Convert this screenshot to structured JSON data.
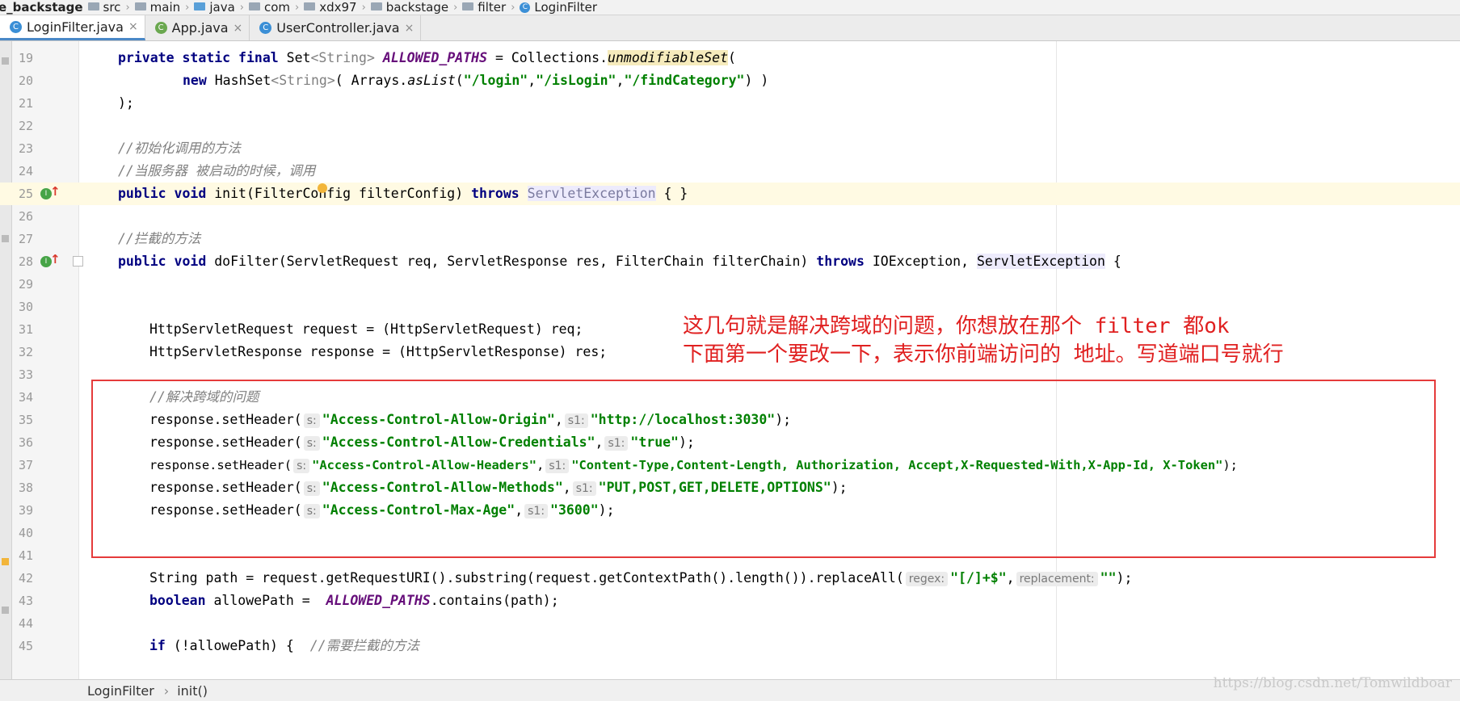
{
  "breadcrumb": [
    "e_backstage",
    "src",
    "main",
    "java",
    "com",
    "xdx97",
    "backstage",
    "filter",
    "LoginFilter"
  ],
  "tabs": [
    {
      "label": "LoginFilter.java",
      "active": true,
      "icon": "class-icon"
    },
    {
      "label": "App.java",
      "active": false,
      "icon": "spring-class-icon"
    },
    {
      "label": "UserController.java",
      "active": false,
      "icon": "class-icon"
    }
  ],
  "tab_close_glyph": "×",
  "line_numbers": [
    "19",
    "20",
    "21",
    "22",
    "23",
    "24",
    "25",
    "26",
    "27",
    "28",
    "29",
    "30",
    "31",
    "32",
    "33",
    "34",
    "35",
    "36",
    "37",
    "38",
    "39",
    "40",
    "41",
    "42",
    "43",
    "44",
    "45"
  ],
  "code": {
    "l19": {
      "private": "private",
      "static": "static",
      "final": "final",
      "set": "Set",
      "gen": "<String>",
      "const": "ALLOWED_PATHS",
      "eq": " = Collections.",
      "method": "unmodifiableSet",
      "tail": "("
    },
    "l20": {
      "new": "new",
      "type": " HashSet",
      "gen": "<String>",
      "mid": "( Arrays.",
      "method": "asList",
      "open": "(",
      "s1": "\"/login\"",
      "c1": ",",
      "s2": "\"/isLogin\"",
      "c2": ",",
      "s3": "\"/findCategory\"",
      "tail": ") )"
    },
    "l21": {
      "text": ");"
    },
    "l23": {
      "comment": "//初始化调用的方法"
    },
    "l24": {
      "comment": "//当服务器 被启动的时候，调用"
    },
    "l25": {
      "public": "public",
      "void": "void",
      "sig": " init(FilterConfig filterConfig) ",
      "throws": "throws",
      "exc": "ServletException",
      "tail": " { }"
    },
    "l27": {
      "comment": "//拦截的方法"
    },
    "l28": {
      "public": "public",
      "void": "void",
      "sig": " doFilter(ServletRequest req, ServletResponse res, FilterChain filterChain) ",
      "throws": "throws",
      "mid": " IOException, ",
      "exc": "ServletException",
      "tail": " {"
    },
    "l31": {
      "text": "HttpServletRequest request = (HttpServletRequest) req;"
    },
    "l32": {
      "text": "HttpServletResponse response = (HttpServletResponse) res;"
    },
    "l34": {
      "comment": "//解决跨域的问题"
    },
    "l35": {
      "pre": "response.setHeader(",
      "h1": "s:",
      "s1": "\"Access-Control-Allow-Origin\"",
      "c": ",",
      "h2": "s1:",
      "s2": "\"http://localhost:3030\"",
      "tail": ");"
    },
    "l36": {
      "pre": "response.setHeader(",
      "h1": "s:",
      "s1": "\"Access-Control-Allow-Credentials\"",
      "c": ",",
      "h2": "s1:",
      "s2": "\"true\"",
      "tail": ");"
    },
    "l37": {
      "pre": "response.setHeader(",
      "h1": "s:",
      "s1": "\"Access-Control-Allow-Headers\"",
      "c": ",",
      "h2": "s1:",
      "s2": "\"Content-Type,Content-Length, Authorization, Accept,X-Requested-With,X-App-Id, X-Token\"",
      "tail": ");"
    },
    "l38": {
      "pre": "response.setHeader(",
      "h1": "s:",
      "s1": "\"Access-Control-Allow-Methods\"",
      "c": ",",
      "h2": "s1:",
      "s2": "\"PUT,POST,GET,DELETE,OPTIONS\"",
      "tail": ");"
    },
    "l39": {
      "pre": "response.setHeader(",
      "h1": "s:",
      "s1": "\"Access-Control-Max-Age\"",
      "c": ",",
      "h2": "s1:",
      "s2": "\"3600\"",
      "tail": ");"
    },
    "l42": {
      "pre": "String path = request.getRequestURI().substring(request.getContextPath().length()).replaceAll(",
      "h1": "regex:",
      "s1": "\"[/]+$\"",
      "c": ",",
      "h2": "replacement:",
      "s2": "\"\"",
      "tail": ");"
    },
    "l43": {
      "boolean": "boolean",
      "mid": " allowePath =  ",
      "const": "ALLOWED_PATHS",
      "tail": ".contains(path);"
    },
    "l45": {
      "if": "if",
      "mid": " (!allowePath) {  ",
      "comment": "//需要拦截的方法"
    }
  },
  "annotation": {
    "line1": "这几句就是解决跨域的问题，你想放在那个 filter 都ok",
    "line2": "下面第一个要改一下，表示你前端访问的 地址。写道端口号就行"
  },
  "status": {
    "class": "LoginFilter",
    "sep": "›",
    "method": "init()"
  },
  "watermark": "https://blog.csdn.net/Tomwildboar",
  "colors": {
    "keyword": "#000080",
    "string": "#008000",
    "comment": "#808080",
    "constant": "#660e7a",
    "annotation": "#e02020",
    "box": "#e53b3b"
  }
}
